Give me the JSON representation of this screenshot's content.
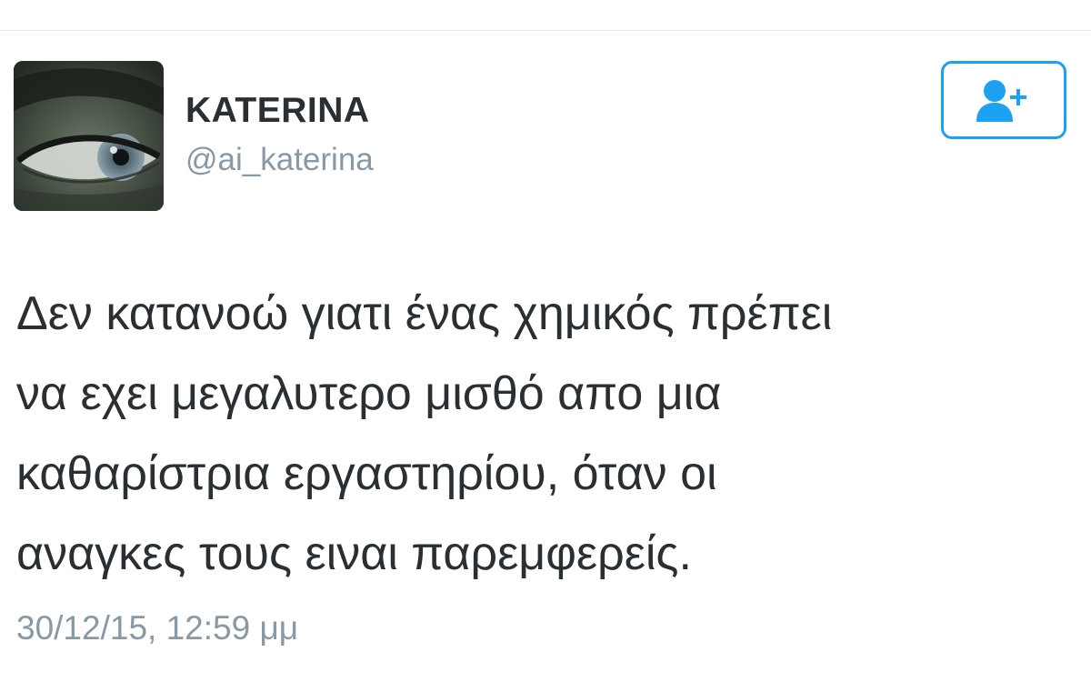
{
  "user": {
    "display_name": "KATERINA",
    "handle": "@ai_katerina",
    "avatar_icon": "profile-photo-eye"
  },
  "follow_button": {
    "icon": "follow-user-icon",
    "color": "#1da1f2"
  },
  "tweet": {
    "text_lines": [
      "Δεν κατανοώ γιατι ένας χημικός πρέπει",
      "να εχει μεγαλυτερο μισθό απο μια",
      "καθαρίστρια εργαστηρίου, όταν οι",
      "αναγκες τους ειναι παρεμφερείς."
    ],
    "timestamp": "30/12/15, 12:59 μμ"
  },
  "colors": {
    "text": "#292f33",
    "muted": "#8899a6",
    "accent": "#1da1f2",
    "divider": "#e1e8ed"
  }
}
